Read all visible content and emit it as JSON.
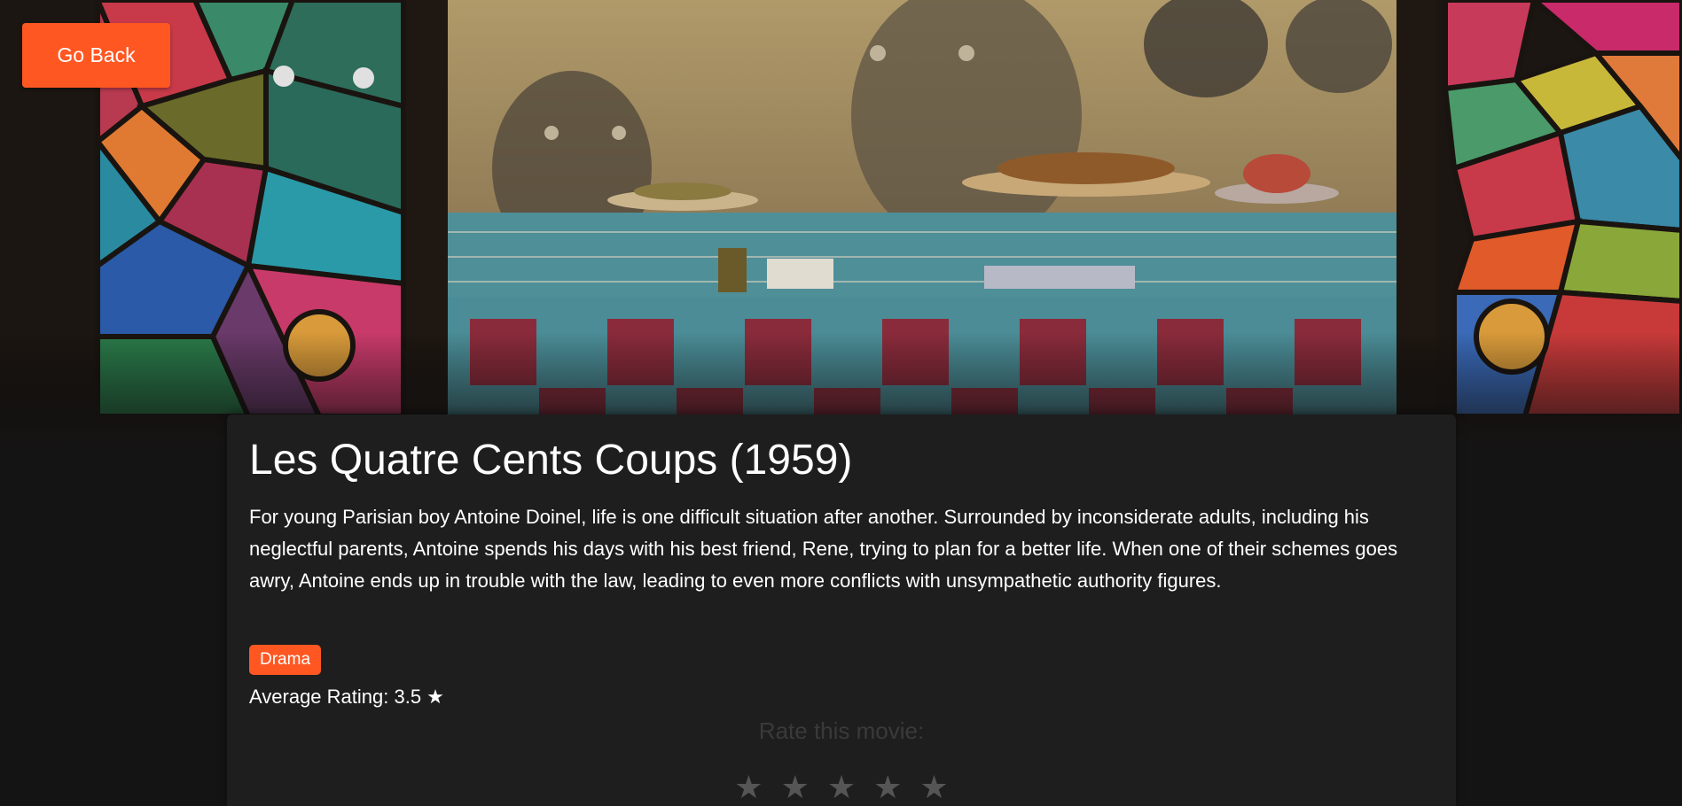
{
  "nav": {
    "back_label": "Go Back"
  },
  "movie": {
    "title": "Les Quatre Cents Coups (1959)",
    "description": "For young Parisian boy Antoine Doinel, life is one difficult situation after another. Surrounded by inconsiderate adults, including his neglectful parents, Antoine spends his days with his best friend, Rene, trying to plan for a better life. When one of their schemes goes awry, Antoine ends up in trouble with the law, leading to even more conflicts with unsympathetic authority figures.",
    "genre": "Drama",
    "rating_text": "Average Rating: 3.5 ★"
  },
  "rate": {
    "label": "Rate this movie:",
    "stars": [
      "★",
      "★",
      "★",
      "★",
      "★"
    ]
  },
  "colors": {
    "accent": "#ff5722",
    "card_bg": "#1e1e1e",
    "page_bg": "#141414"
  },
  "icons": {
    "star": "star-icon"
  }
}
